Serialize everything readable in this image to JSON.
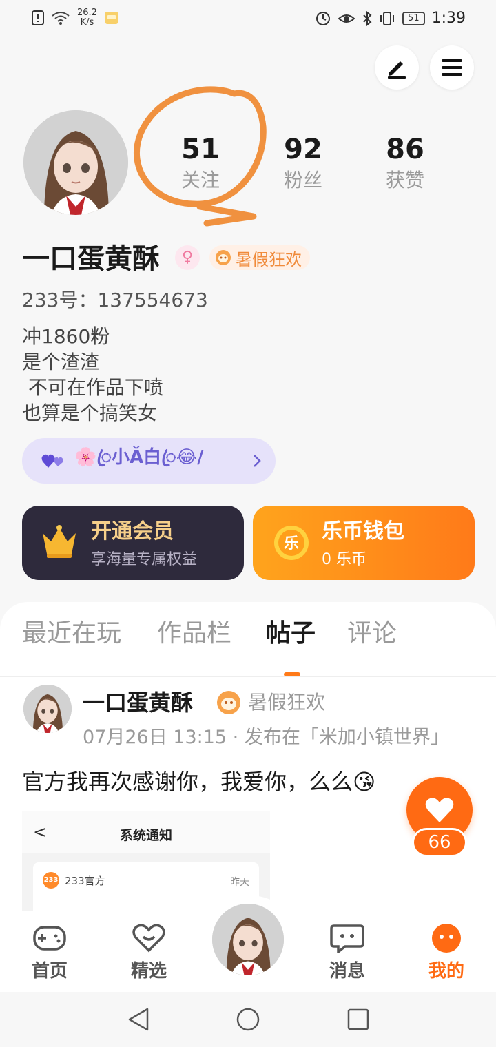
{
  "status_bar": {
    "speed_value": "26.2",
    "speed_unit": "K/s",
    "battery": "51",
    "time": "1:39"
  },
  "profile": {
    "stats": [
      {
        "value": "51",
        "label": "关注"
      },
      {
        "value": "92",
        "label": "粉丝"
      },
      {
        "value": "86",
        "label": "获赞"
      }
    ],
    "username": "一口蛋黄酥",
    "event_badge": "暑假狂欢",
    "uid": "233号：137554673",
    "bio": [
      "冲1860粉",
      "是个渣渣",
      " 不可在作品下喷",
      "也算是个搞笑女"
    ],
    "tag_text": "🌸ꦿ小Ǎ白ꦿ😂/"
  },
  "cards": {
    "vip": {
      "title": "开通会员",
      "subtitle": "享海量专属权益"
    },
    "wallet": {
      "title": "乐币钱包",
      "subtitle": "0 乐币",
      "coin_glyph": "乐"
    }
  },
  "tabs": [
    "最近在玩",
    "作品栏",
    "帖子",
    "评论"
  ],
  "post": {
    "author": "一口蛋黄酥",
    "badge": "暑假狂欢",
    "meta": "07月26日 13:15 · 发布在「米加小镇世界」",
    "text": "官方我再次感谢你，我爱你，么么😘",
    "image": {
      "back": "<",
      "title": "系统通知",
      "logo": "233",
      "sender": "233官方",
      "time": "昨天"
    },
    "likes": "66"
  },
  "bottom_nav": [
    {
      "label": "首页"
    },
    {
      "label": "精选"
    },
    {
      "label": "消息"
    },
    {
      "label": "我的"
    }
  ],
  "colors": {
    "accent": "#ff6a13",
    "annotation": "#f0913f"
  }
}
